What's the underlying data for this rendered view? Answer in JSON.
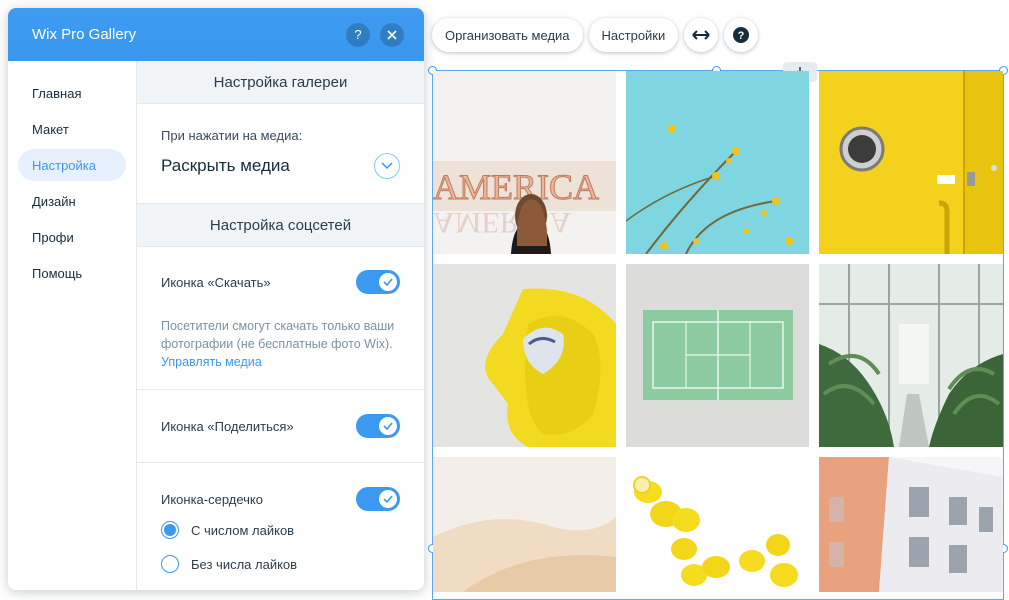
{
  "panel": {
    "title": "Wix Pro Gallery",
    "help_icon": "question-icon",
    "close_icon": "close-icon"
  },
  "sidebar": {
    "items": [
      {
        "label": "Главная",
        "active": false
      },
      {
        "label": "Макет",
        "active": false
      },
      {
        "label": "Настройка",
        "active": true
      },
      {
        "label": "Дизайн",
        "active": false
      },
      {
        "label": "Профи",
        "active": false
      },
      {
        "label": "Помощь",
        "active": false
      }
    ]
  },
  "gallery_settings": {
    "section_title": "Настройка галереи",
    "click_label": "При нажатии на медиа:",
    "click_value": "Раскрыть медиа"
  },
  "social_settings": {
    "section_title": "Настройка соцсетей",
    "download": {
      "label": "Иконка «Скачать»",
      "enabled": true,
      "hint": "Посетители смогут скачать только ваши фотографии (не бесплатные фото Wix).",
      "link": "Управлять медиа"
    },
    "share": {
      "label": "Иконка «Поделиться»",
      "enabled": true
    },
    "love": {
      "label": "Иконка-сердечко",
      "enabled": true,
      "options": [
        {
          "label": "С числом лайков",
          "selected": true
        },
        {
          "label": "Без числа лайков",
          "selected": false
        }
      ]
    }
  },
  "toolbar": {
    "organize_label": "Организовать медиа",
    "settings_label": "Настройки",
    "stretch_icon": "stretch-arrows-icon",
    "help_icon": "help-icon"
  },
  "gallery": {
    "download_icon": "download-icon",
    "images": [
      "america-sign-photo",
      "yellow-flowers-sky-photo",
      "yellow-door-porthole-photo",
      "yellow-sofa-photo",
      "tennis-court-photo",
      "greenhouse-plants-photo",
      "sand-dunes-photo",
      "lemons-photo",
      "building-facade-photo"
    ]
  },
  "colors": {
    "accent": "#3b99f0",
    "header": "#3b99f0",
    "active_bg": "#e7f0ff"
  }
}
